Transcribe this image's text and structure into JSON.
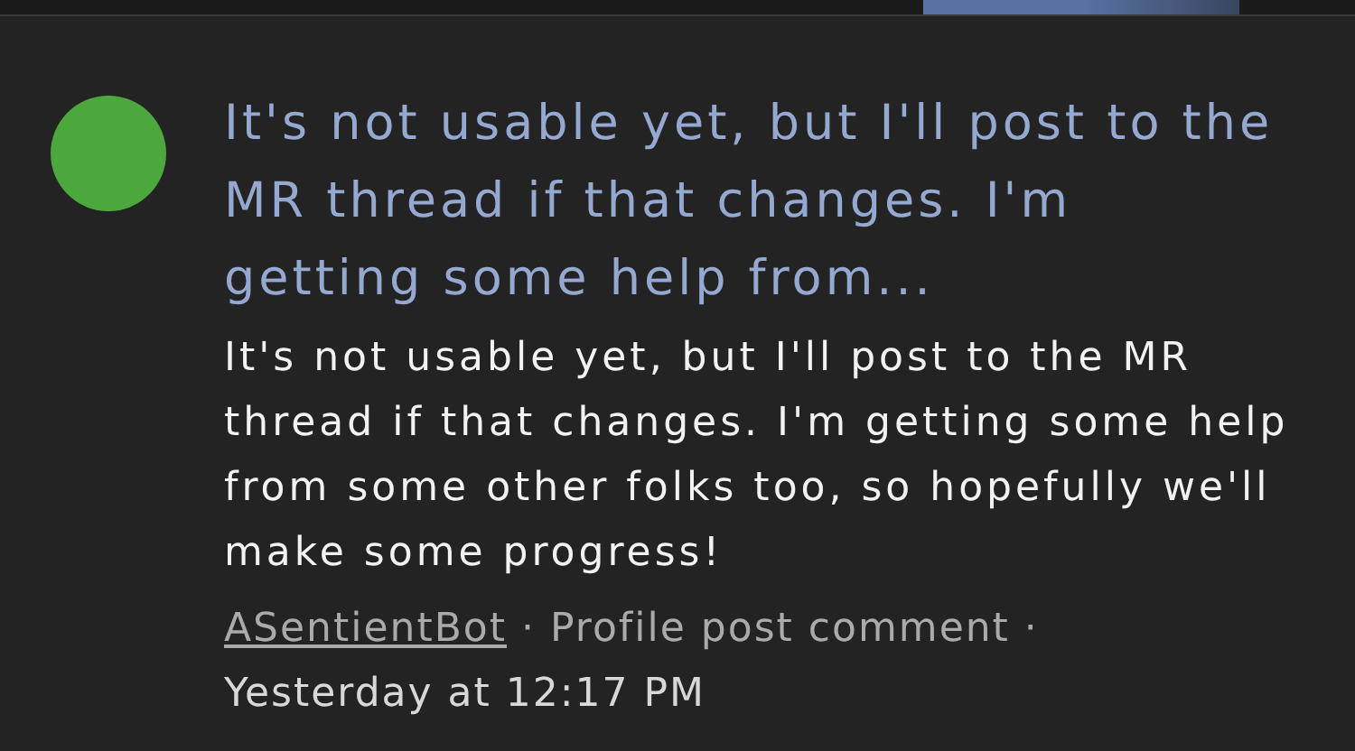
{
  "post": {
    "title": "It's not usable yet, but I'll post to the MR thread if that changes. I'm getting some help from...",
    "body": "It's not usable yet, but I'll post to the MR thread if that changes. I'm getting some help from some other folks too, so hopefully we'll make some progress!",
    "author": "ASentientBot",
    "type": "· Profile post comment ·",
    "time": "Yesterday at 12:17 PM",
    "avatar": {
      "color": "#4ca83c"
    }
  }
}
